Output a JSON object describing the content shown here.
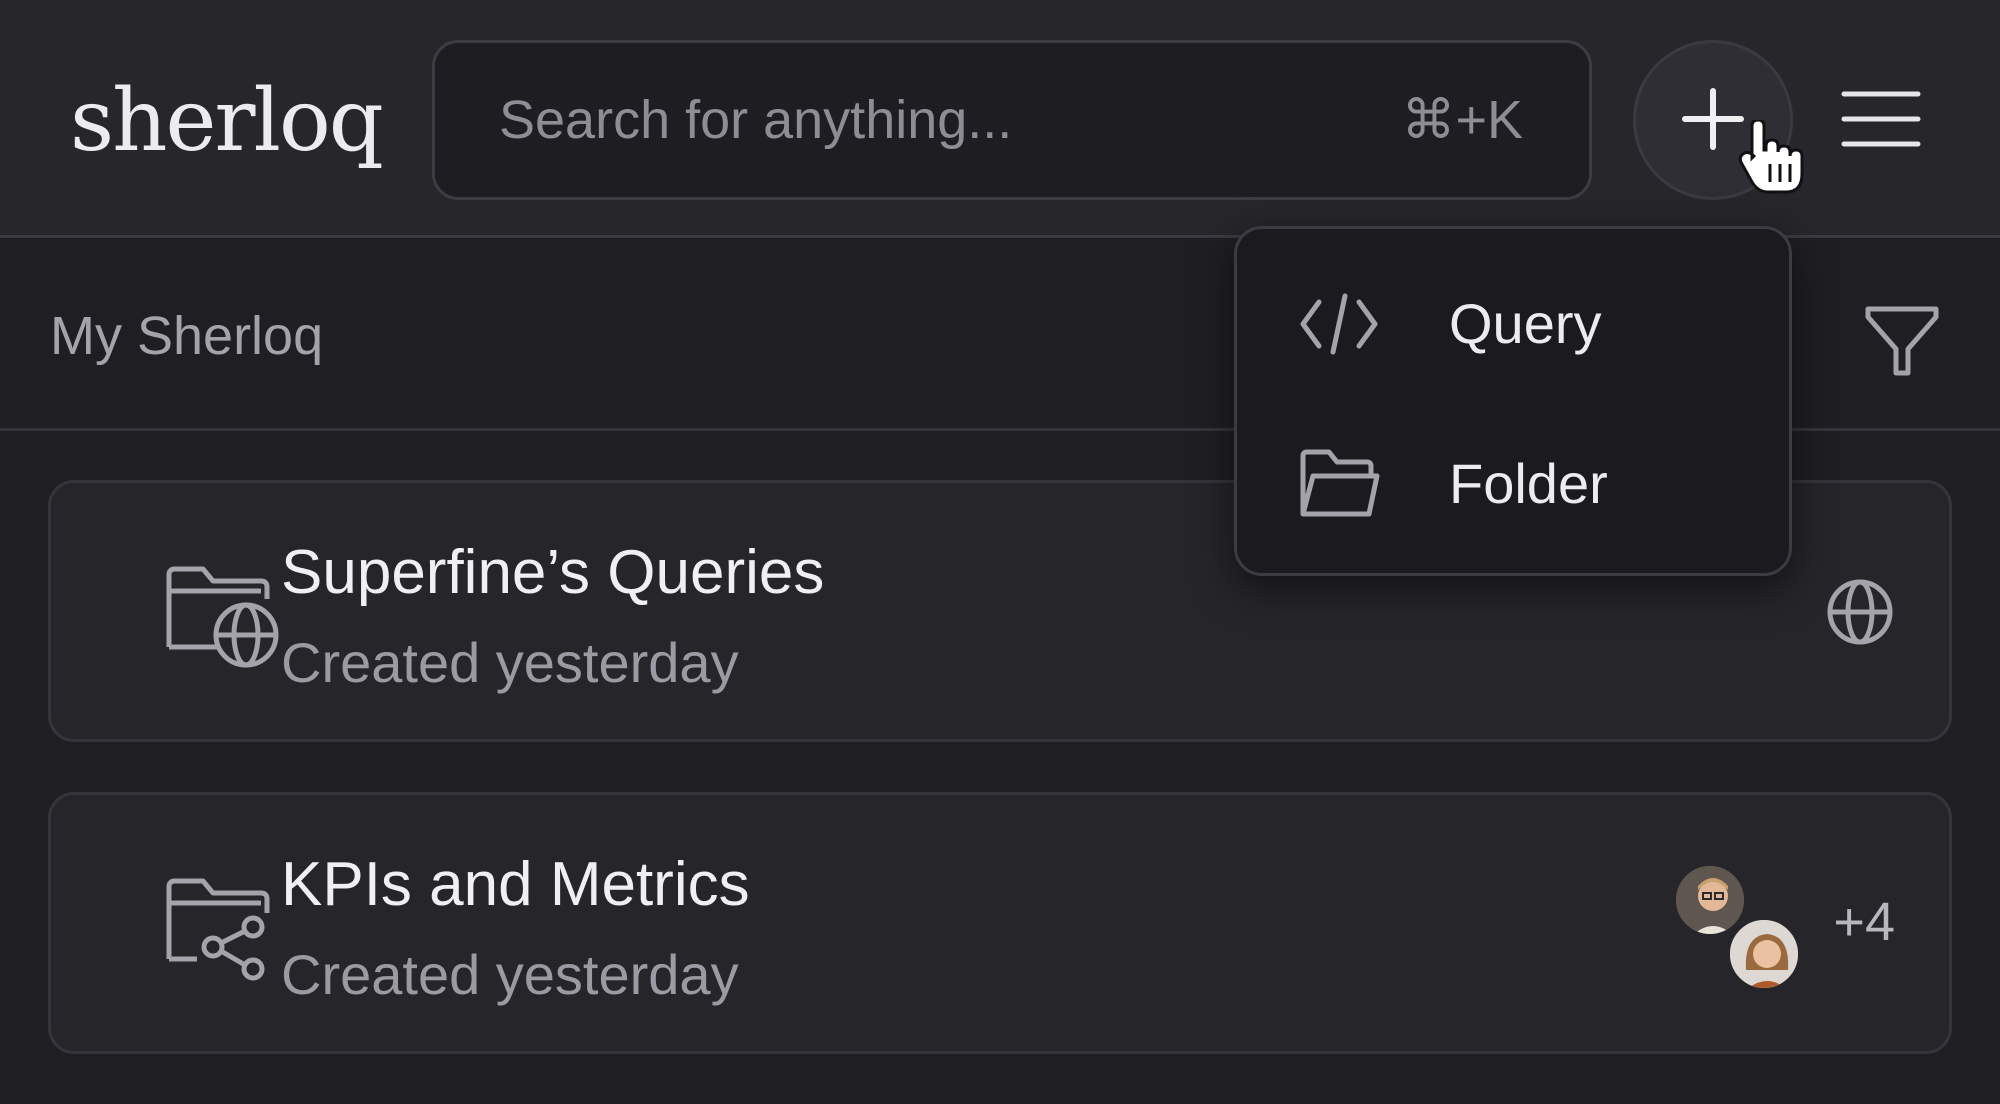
{
  "header": {
    "logo": "sherloq",
    "search": {
      "placeholder": "Search for anything...",
      "shortcut": "⌘+K"
    },
    "add_button_icon": "plus-icon",
    "menu_icon": "hamburger-menu-icon"
  },
  "subheader": {
    "title": "My Sherloq",
    "filter_icon": "filter-icon"
  },
  "folders": [
    {
      "title": "Superfine’s Queries",
      "subtitle": "Created yesterday",
      "icon": "folder-globe-icon",
      "visibility_icon": "globe-icon"
    },
    {
      "title": "KPIs and Metrics",
      "subtitle": "Created yesterday",
      "icon": "folder-share-icon",
      "extra_members": "+4"
    }
  ],
  "new_menu": {
    "items": [
      {
        "label": "Query",
        "icon": "code-icon"
      },
      {
        "label": "Folder",
        "icon": "folder-open-icon"
      }
    ]
  },
  "colors": {
    "background": "#1f1f23",
    "header": "#26262b",
    "card": "#25252a",
    "dropdown": "#1b1b1f",
    "text_primary": "#f0f0f3",
    "text_muted": "#9a9aa2"
  }
}
